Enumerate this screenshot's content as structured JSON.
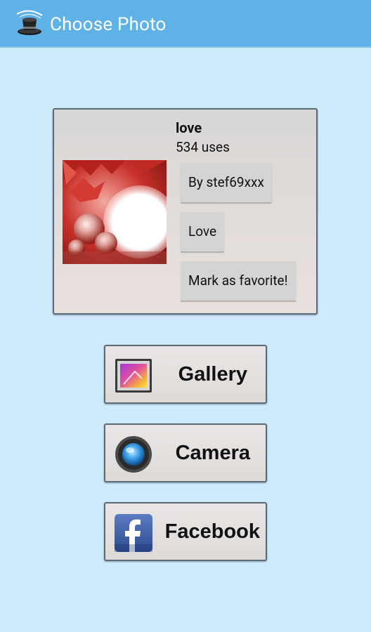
{
  "appbar": {
    "title": "Choose Photo",
    "icon": "magic-hat-icon"
  },
  "photo_card": {
    "title": "love",
    "uses": "534 uses",
    "author_button": "By stef69xxx",
    "category_button": "Love",
    "favorite_button": "Mark as favorite!"
  },
  "sources": {
    "gallery": {
      "label": "Gallery",
      "icon": "gallery-icon"
    },
    "camera": {
      "label": "Camera",
      "icon": "camera-icon"
    },
    "facebook": {
      "label": "Facebook",
      "icon": "facebook-icon"
    }
  },
  "colors": {
    "appbar": "#5fb2e6",
    "background": "#cfeafb",
    "facebook_blue": "#3b5998"
  }
}
